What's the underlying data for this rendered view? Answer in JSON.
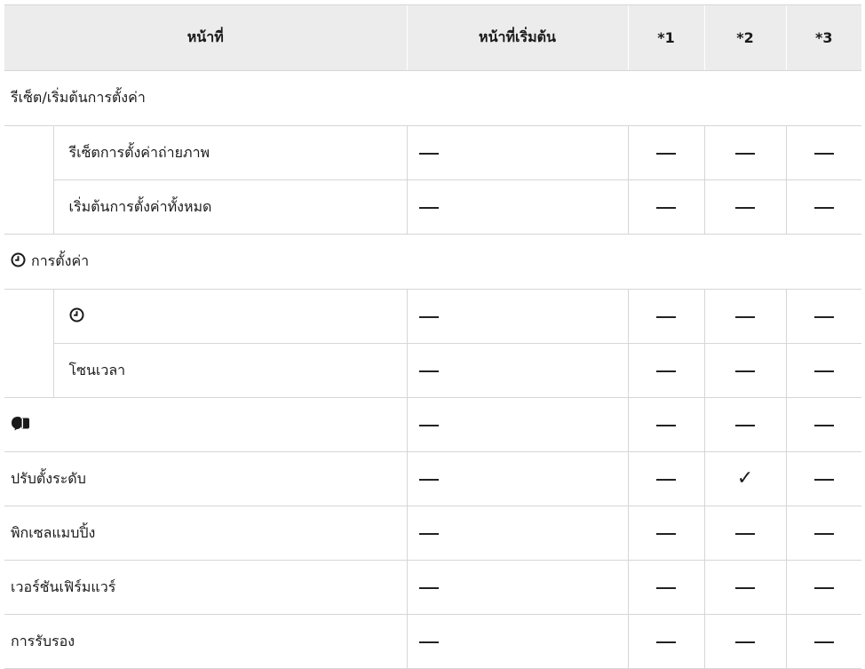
{
  "header": {
    "function": "หน้าที่",
    "default": "หน้าที่เริ่มต้น",
    "col1": "*1",
    "col2": "*2",
    "col3": "*3"
  },
  "rows": {
    "reset_section": "รีเซ็ต/เริ่มต้นการตั้งค่า",
    "reset_shooting": "รีเซ็ตการตั้งค่าถ่ายภาพ",
    "initialize_all": "เริ่มต้นการตั้งค่าทั้งหมด",
    "clock_section": "การตั้งค่า",
    "time_zone": "โซนเวลา",
    "level_adjust": "ปรับตั้งระดับ",
    "pixel_mapping": "พิกเซลแมบปิ้ง",
    "firmware": "เวอร์ชันเฟิร์มแวร์",
    "certification": "การรับรอง"
  },
  "icons": {
    "clock": "clock-icon",
    "language": "language-icon",
    "dash": "em-dash",
    "check": "check-mark"
  },
  "symbols": {
    "check": "✓"
  },
  "colors": {
    "header_bg": "#ececec",
    "border": "#d6d6d6",
    "text": "#1a1a1a"
  }
}
